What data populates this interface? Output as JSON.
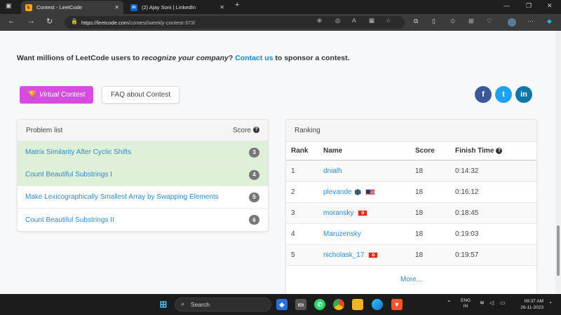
{
  "browser": {
    "tabs": [
      {
        "title": "Contest - LeetCode",
        "icon": "leetcode-icon",
        "active": true
      },
      {
        "title": "(2) Ajay Soni | LinkedIn",
        "icon": "linkedin-icon",
        "active": false
      }
    ],
    "url_host": "https://leetcode.com",
    "url_path": "/contest/weekly-contest-373/"
  },
  "page": {
    "sponsor": {
      "prefix": "Want millions of LeetCode users to ",
      "italic": "recognize your company",
      "middle": "? ",
      "link": "Contact us",
      "suffix": " to sponsor a contest."
    },
    "buttons": {
      "virtual_italic": "Virtual",
      "virtual_rest": "Contest",
      "faq": "FAQ about Contest"
    },
    "social": [
      {
        "name": "facebook",
        "glyph": "f",
        "color": "#3b5998"
      },
      {
        "name": "twitter",
        "glyph": "t",
        "color": "#1da1f2"
      },
      {
        "name": "linkedin",
        "glyph": "in",
        "color": "#0e76a8"
      }
    ],
    "problem_list": {
      "title": "Problem list",
      "score_label": "Score",
      "help_glyph": "?",
      "rows": [
        {
          "title": "Matrix Similarity After Cyclic Shifts",
          "score": "3",
          "solved": true
        },
        {
          "title": "Count Beautiful Substrings I",
          "score": "4",
          "solved": true
        },
        {
          "title": "Make Lexicographically Smallest Array by Swapping Elements",
          "score": "5",
          "solved": false
        },
        {
          "title": "Count Beautiful Substrings II",
          "score": "6",
          "solved": false
        }
      ]
    },
    "ranking": {
      "title": "Ranking",
      "columns": {
        "rank": "Rank",
        "name": "Name",
        "score": "Score",
        "finish_time": "Finish Time"
      },
      "help_glyph": "?",
      "rows": [
        {
          "rank": "1",
          "name": "dnialh",
          "score": "18",
          "time": "0:14:32",
          "flag": ""
        },
        {
          "rank": "2",
          "name": "plevande",
          "score": "18",
          "time": "0:16:12",
          "flag": "us",
          "badge": true
        },
        {
          "rank": "3",
          "name": "moransky",
          "score": "18",
          "time": "0:18:45",
          "flag": "hk"
        },
        {
          "rank": "4",
          "name": "Maruzensky",
          "score": "18",
          "time": "0:19:03",
          "flag": ""
        },
        {
          "rank": "5",
          "name": "nicholask_17",
          "score": "18",
          "time": "0:19:57",
          "flag": "hk"
        }
      ],
      "more": "More..."
    }
  },
  "taskbar": {
    "search_label": "Search",
    "lang_line1": "ENG",
    "lang_line2": "IN",
    "time": "09:37 AM",
    "date": "26-11-2023"
  },
  "colors": {
    "accent_link": "#2d8ac9",
    "virtual_button": "#d84be0",
    "solved_row": "#dff0d8"
  }
}
